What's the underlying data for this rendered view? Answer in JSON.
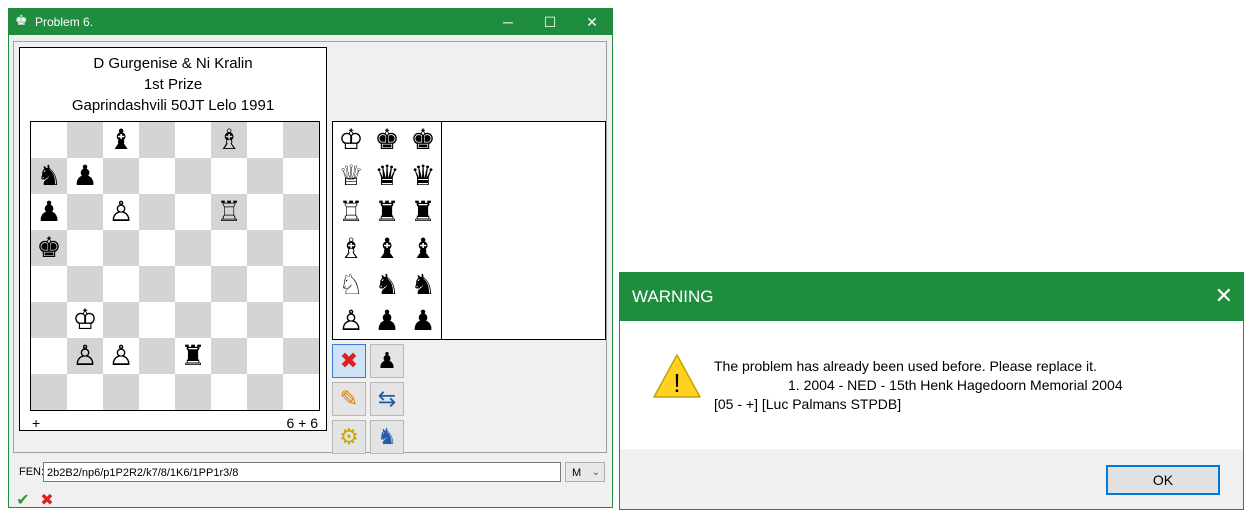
{
  "main_window": {
    "title": "Problem 6.",
    "app_icon": "♚",
    "minimize": "─",
    "maximize": "☐",
    "close": "✕"
  },
  "diagram": {
    "authors": "D Gurgenise & Ni Kralin",
    "award": "1st Prize",
    "source": "Gaprindashvili 50JT Lelo 1991",
    "stipulation": "+",
    "piece_count": "6 + 6",
    "board": [
      [
        "",
        "",
        "♝",
        "",
        "",
        "♗",
        "",
        ""
      ],
      [
        "♞",
        "♟",
        "",
        "",
        "",
        "",
        "",
        ""
      ],
      [
        "♟",
        "",
        "♙",
        "",
        "",
        "♖",
        "",
        ""
      ],
      [
        "♚",
        "",
        "",
        "",
        "",
        "",
        "",
        ""
      ],
      [
        "",
        "",
        "",
        "",
        "",
        "",
        "",
        ""
      ],
      [
        "",
        "♔",
        "",
        "",
        "",
        "",
        "",
        ""
      ],
      [
        "",
        "♙",
        "♙",
        "",
        "♜",
        "",
        "",
        ""
      ],
      [
        "",
        "",
        "",
        "",
        "",
        "",
        "",
        ""
      ]
    ]
  },
  "palette": [
    [
      "♔",
      "♚",
      "♚"
    ],
    [
      "♕",
      "♛",
      "♛"
    ],
    [
      "♖",
      "♜",
      "♜"
    ],
    [
      "♗",
      "♝",
      "♝"
    ],
    [
      "♘",
      "♞",
      "♞"
    ],
    [
      "♙",
      "♟",
      "♟"
    ]
  ],
  "tools": {
    "clear": "✖",
    "piece": "♟",
    "edit": "✎",
    "flip": "⇆",
    "settings": "⚙",
    "solver": "♞"
  },
  "fen": {
    "label": "FEN:",
    "value": "2b2B2/np6/p1P2R2/k7/8/1K6/1PP1r3/8",
    "mode": "M"
  },
  "bottom_buttons": {
    "accept": "✔",
    "reject": "✖"
  },
  "warning": {
    "title": "WARNING",
    "close": "✕",
    "icon": "!",
    "line1": "The problem has already been used before. Please replace it.",
    "line2": "1. 2004 - NED - 15th Henk Hagedoorn Memorial 2004",
    "line3": "[05 - +] [Luc Palmans STPDB]",
    "ok": "OK"
  },
  "colors": {
    "titlebar": "#1e8e3e",
    "dark_square": "#d4d4d4",
    "light_square": "#ffffff",
    "warning_yellow": "#ffd21f",
    "ok_border": "#0078d7"
  }
}
